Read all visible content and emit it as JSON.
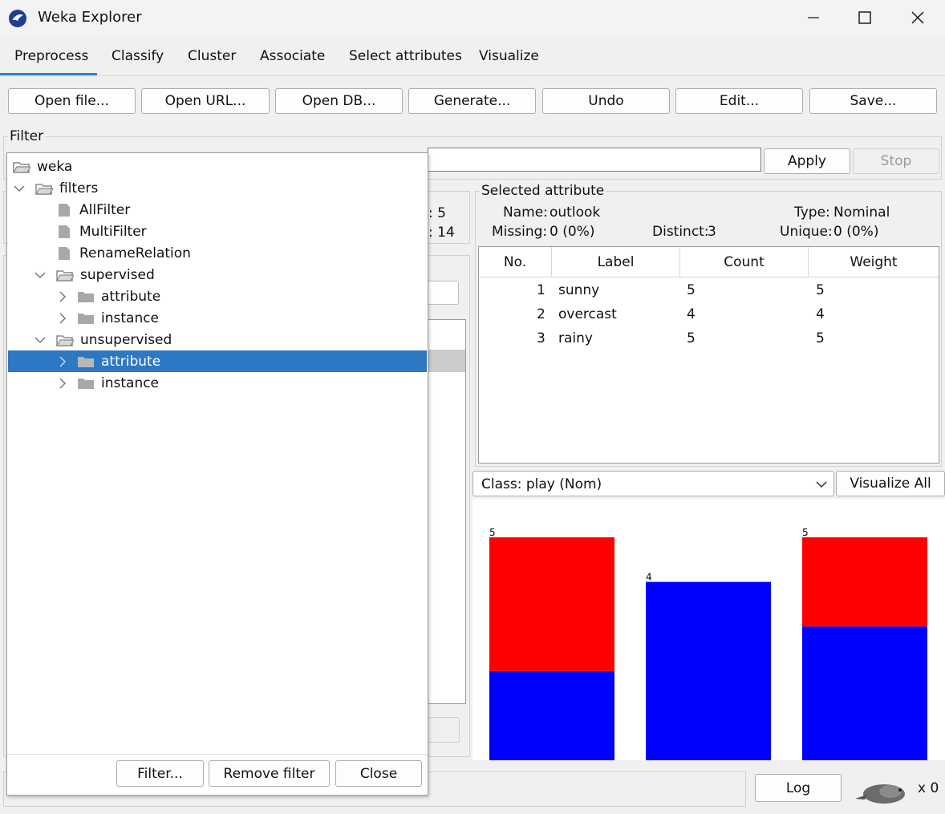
{
  "window": {
    "title": "Weka Explorer",
    "minimize": "—",
    "maximize": "☐",
    "close": "✕"
  },
  "tabs": [
    "Preprocess",
    "Classify",
    "Cluster",
    "Associate",
    "Select attributes",
    "Visualize"
  ],
  "toolbar": [
    "Open file...",
    "Open URL...",
    "Open DB...",
    "Generate...",
    "Undo",
    "Edit...",
    "Save..."
  ],
  "filter": {
    "legend": "Filter",
    "apply": "Apply",
    "stop": "Stop"
  },
  "partial": {
    "val1": ": 5",
    "val2": ": 14"
  },
  "tree": {
    "root": "weka",
    "filters": "filters",
    "all_filter": "AllFilter",
    "multi_filter": "MultiFilter",
    "rename_relation": "RenameRelation",
    "supervised": "supervised",
    "sup_attribute": "attribute",
    "sup_instance": "instance",
    "unsupervised": "unsupervised",
    "unsup_attribute": "attribute",
    "unsup_instance": "instance",
    "btn_filter": "Filter...",
    "btn_remove": "Remove filter",
    "btn_close": "Close"
  },
  "selected_attribute": {
    "legend": "Selected attribute",
    "name_label": "Name:",
    "name": "outlook",
    "type_label": "Type:",
    "type": "Nominal",
    "missing_label": "Missing:",
    "missing": "0 (0%)",
    "distinct_label": "Distinct:",
    "distinct": "3",
    "unique_label": "Unique:",
    "unique": "0 (0%)",
    "columns": [
      "No.",
      "Label",
      "Count",
      "Weight"
    ],
    "rows": [
      {
        "no": "1",
        "label": "sunny",
        "count": "5",
        "weight": "5"
      },
      {
        "no": "2",
        "label": "overcast",
        "count": "4",
        "weight": "4"
      },
      {
        "no": "3",
        "label": "rainy",
        "count": "5",
        "weight": "5"
      }
    ]
  },
  "class_select": {
    "value": "Class: play (Nom)",
    "visualize_all": "Visualize All"
  },
  "status": {
    "log": "Log",
    "count": "x 0"
  },
  "colors": {
    "red": "#ff0000",
    "blue": "#0000ff",
    "selection": "#2c78c2",
    "tab_accent": "#2f7ed8"
  },
  "chart_data": {
    "type": "bar",
    "categories": [
      "sunny",
      "overcast",
      "rainy"
    ],
    "series": [
      {
        "values": [
          2,
          4,
          3
        ],
        "color": "#0000ff"
      },
      {
        "values": [
          3,
          0,
          2
        ],
        "color": "#ff0000"
      }
    ],
    "totals": [
      5,
      4,
      5
    ],
    "data_labels": [
      "5",
      "4",
      "5"
    ],
    "ylim": [
      0,
      5
    ]
  }
}
